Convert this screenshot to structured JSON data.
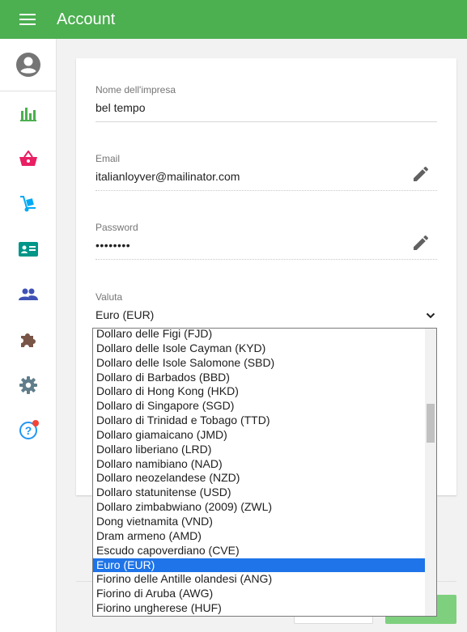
{
  "appbar": {
    "title": "Account"
  },
  "sidebar": {
    "items": [
      {
        "name": "account",
        "icon": "account-circle-icon",
        "color": "#757575"
      },
      {
        "name": "statistics",
        "icon": "bar-chart-icon",
        "color": "#4caf50"
      },
      {
        "name": "shop",
        "icon": "shopping-basket-icon",
        "color": "#e91e63"
      },
      {
        "name": "delivery",
        "icon": "hand-truck-icon",
        "color": "#03a9f4"
      },
      {
        "name": "contacts",
        "icon": "contact-card-icon",
        "color": "#009688"
      },
      {
        "name": "people",
        "icon": "people-icon",
        "color": "#3f51b5"
      },
      {
        "name": "extensions",
        "icon": "puzzle-icon",
        "color": "#795548"
      },
      {
        "name": "settings",
        "icon": "gear-icon",
        "color": "#607d8b"
      },
      {
        "name": "help",
        "icon": "help-icon",
        "color": "#2196f3",
        "badge": true
      }
    ]
  },
  "form": {
    "company": {
      "label": "Nome dell'impresa",
      "value": "bel tempo"
    },
    "email": {
      "label": "Email",
      "value": "italianloyver@mailinator.com"
    },
    "password": {
      "label": "Password",
      "value": "••••••••"
    },
    "currency": {
      "label": "Valuta",
      "value": "Euro (EUR)"
    }
  },
  "currency_options": [
    "Dollaro delle Figi (FJD)",
    "Dollaro delle Isole Cayman (KYD)",
    "Dollaro delle Isole Salomone (SBD)",
    "Dollaro di Barbados (BBD)",
    "Dollaro di Hong Kong (HKD)",
    "Dollaro di Singapore (SGD)",
    "Dollaro di Trinidad e Tobago (TTD)",
    "Dollaro giamaicano (JMD)",
    "Dollaro liberiano (LRD)",
    "Dollaro namibiano (NAD)",
    "Dollaro neozelandese (NZD)",
    "Dollaro statunitense (USD)",
    "Dollaro zimbabwiano (2009) (ZWL)",
    "Dong vietnamita (VND)",
    "Dram armeno (AMD)",
    "Escudo capoverdiano (CVE)",
    "Euro (EUR)",
    "Fiorino delle Antille olandesi (ANG)",
    "Fiorino di Aruba (AWG)",
    "Fiorino ungherese (HUF)"
  ],
  "selected_currency_index": 16,
  "colors": {
    "primary": "#4caf50",
    "selection": "#1e74e8",
    "badge": "#f44336"
  }
}
